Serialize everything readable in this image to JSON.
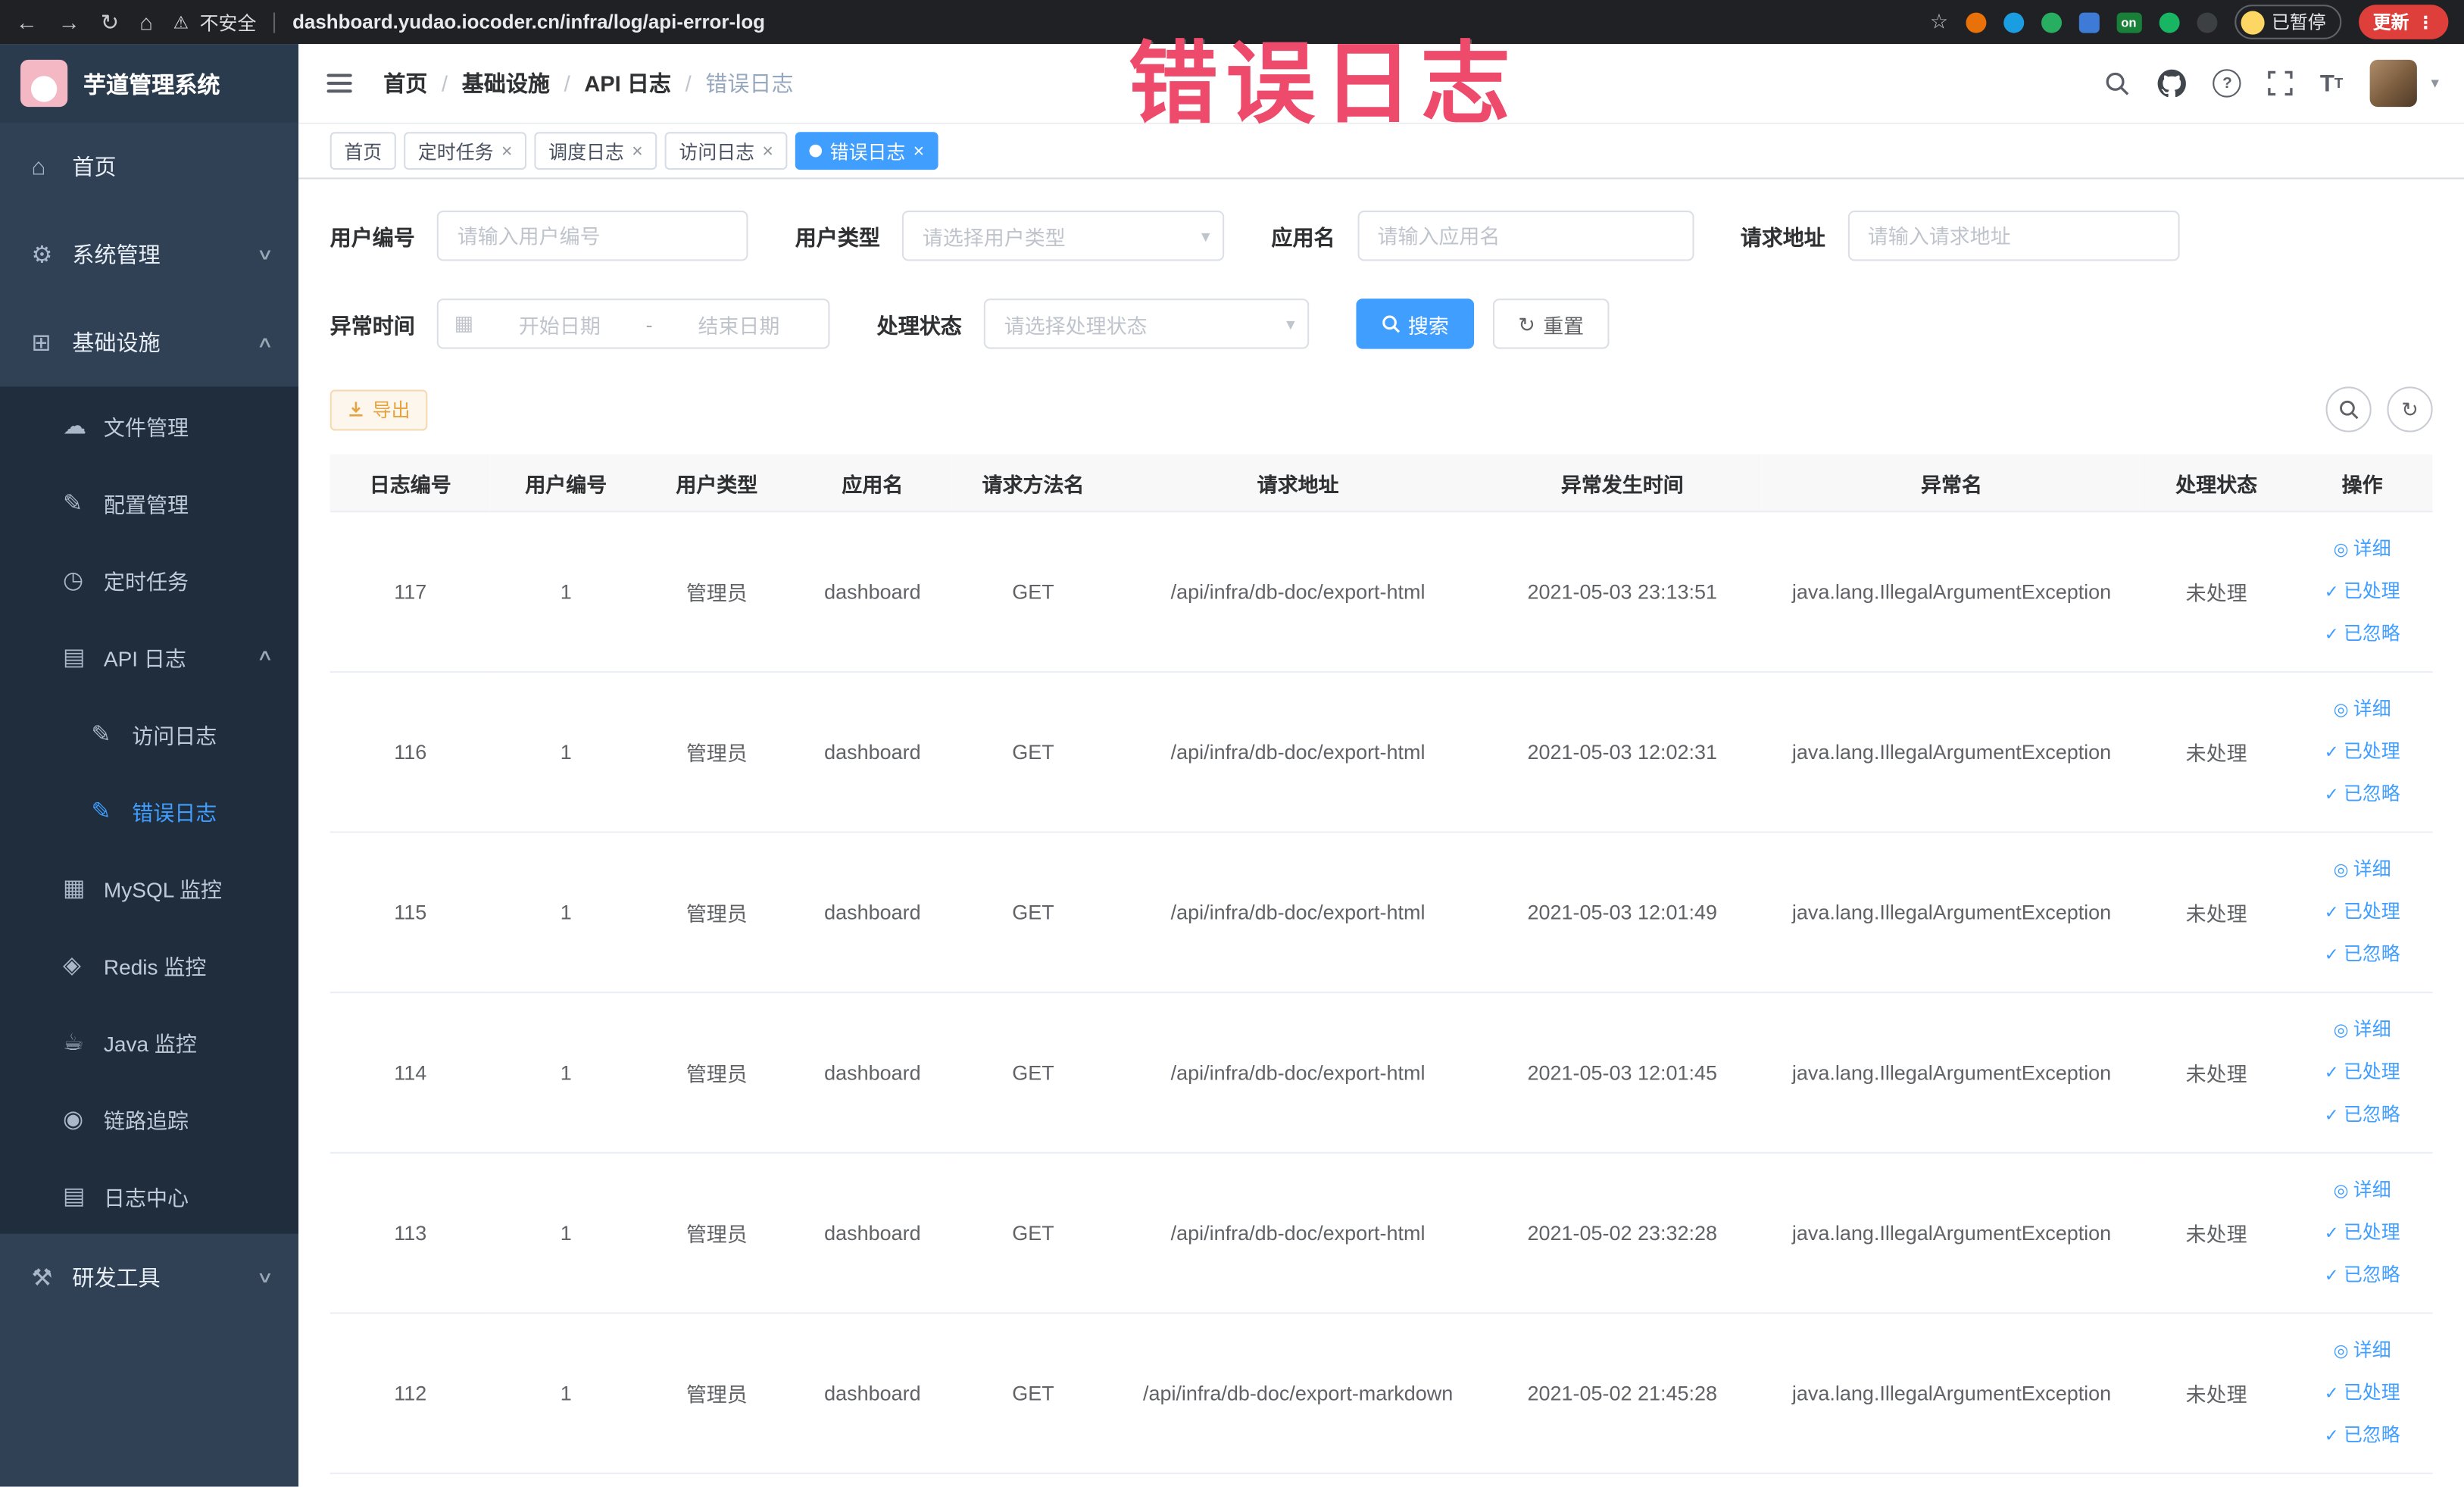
{
  "browser": {
    "security_label": "不安全",
    "url": "dashboard.yudao.iocoder.cn/infra/log/api-error-log",
    "extension_on_label": "on",
    "profile_paused_label": "已暂停",
    "update_label": "更新"
  },
  "annotation": {
    "text": "错误日志",
    "color": "#ee4a6b"
  },
  "sidebar": {
    "logo_title": "芋道管理系统",
    "items": [
      {
        "id": "home",
        "label": "首页",
        "icon": "home-icon",
        "glyph": "⌂",
        "level": 1
      },
      {
        "id": "system-management",
        "label": "系统管理",
        "icon": "gear-icon",
        "glyph": "⚙",
        "level": 1,
        "chevron": "down"
      },
      {
        "id": "infrastructure",
        "label": "基础设施",
        "icon": "infrastructure-icon",
        "glyph": "⊞",
        "level": 1,
        "chevron": "up"
      },
      {
        "id": "file-management",
        "label": "文件管理",
        "icon": "cloud-icon",
        "glyph": "☁",
        "level": 2
      },
      {
        "id": "config-management",
        "label": "配置管理",
        "icon": "edit-icon",
        "glyph": "✎",
        "level": 2
      },
      {
        "id": "scheduled-tasks",
        "label": "定时任务",
        "icon": "timer-icon",
        "glyph": "◷",
        "level": 2
      },
      {
        "id": "api-logs",
        "label": "API 日志",
        "icon": "log-icon",
        "glyph": "▤",
        "level": 2,
        "chevron": "up"
      },
      {
        "id": "access-log",
        "label": "访问日志",
        "icon": "edit-square-icon",
        "glyph": "✎",
        "level": 3
      },
      {
        "id": "error-log",
        "label": "错误日志",
        "icon": "edit-square-icon",
        "glyph": "✎",
        "level": 3,
        "active": true
      },
      {
        "id": "mysql-monitor",
        "label": "MySQL 监控",
        "icon": "monitor-icon",
        "glyph": "▦",
        "level": 2
      },
      {
        "id": "redis-monitor",
        "label": "Redis 监控",
        "icon": "database-icon",
        "glyph": "◈",
        "level": 2
      },
      {
        "id": "java-monitor",
        "label": "Java 监控",
        "icon": "coffee-icon",
        "glyph": "☕",
        "level": 2
      },
      {
        "id": "link-trace",
        "label": "链路追踪",
        "icon": "eye-icon",
        "glyph": "◉",
        "level": 2
      },
      {
        "id": "log-center",
        "label": "日志中心",
        "icon": "log-icon",
        "glyph": "▤",
        "level": 2
      },
      {
        "id": "dev-tools",
        "label": "研发工具",
        "icon": "tools-icon",
        "glyph": "⚒",
        "level": 1,
        "chevron": "down"
      }
    ]
  },
  "topbar": {
    "breadcrumb": [
      "首页",
      "基础设施",
      "API 日志",
      "错误日志"
    ],
    "breadcrumb_separator": "/"
  },
  "tags": [
    {
      "label": "首页",
      "closable": false,
      "active": false
    },
    {
      "label": "定时任务",
      "closable": true,
      "active": false
    },
    {
      "label": "调度日志",
      "closable": true,
      "active": false
    },
    {
      "label": "访问日志",
      "closable": true,
      "active": false
    },
    {
      "label": "错误日志",
      "closable": true,
      "active": true
    }
  ],
  "filters": {
    "user_id": {
      "label": "用户编号",
      "placeholder": "请输入用户编号",
      "value": ""
    },
    "user_type": {
      "label": "用户类型",
      "placeholder": "请选择用户类型"
    },
    "app_name": {
      "label": "应用名",
      "placeholder": "请输入应用名",
      "value": ""
    },
    "request_url": {
      "label": "请求地址",
      "placeholder": "请输入请求地址",
      "value": ""
    },
    "exception_time": {
      "label": "异常时间",
      "start_placeholder": "开始日期",
      "separator": "-",
      "end_placeholder": "结束日期"
    },
    "process_status": {
      "label": "处理状态",
      "placeholder": "请选择处理状态"
    },
    "search_label": "搜索",
    "reset_label": "重置"
  },
  "toolbar": {
    "export_label": "导出"
  },
  "table": {
    "columns": [
      "日志编号",
      "用户编号",
      "用户类型",
      "应用名",
      "请求方法名",
      "请求地址",
      "异常发生时间",
      "异常名",
      "处理状态",
      "操作"
    ],
    "rows": [
      [
        "117",
        "1",
        "管理员",
        "dashboard",
        "GET",
        "/api/infra/db-doc/export-html",
        "2021-05-03 23:13:51",
        "java.lang.IllegalArgumentException",
        "未处理"
      ],
      [
        "116",
        "1",
        "管理员",
        "dashboard",
        "GET",
        "/api/infra/db-doc/export-html",
        "2021-05-03 12:02:31",
        "java.lang.IllegalArgumentException",
        "未处理"
      ],
      [
        "115",
        "1",
        "管理员",
        "dashboard",
        "GET",
        "/api/infra/db-doc/export-html",
        "2021-05-03 12:01:49",
        "java.lang.IllegalArgumentException",
        "未处理"
      ],
      [
        "114",
        "1",
        "管理员",
        "dashboard",
        "GET",
        "/api/infra/db-doc/export-html",
        "2021-05-03 12:01:45",
        "java.lang.IllegalArgumentException",
        "未处理"
      ],
      [
        "113",
        "1",
        "管理员",
        "dashboard",
        "GET",
        "/api/infra/db-doc/export-html",
        "2021-05-02 23:32:28",
        "java.lang.IllegalArgumentException",
        "未处理"
      ],
      [
        "112",
        "1",
        "管理员",
        "dashboard",
        "GET",
        "/api/infra/db-doc/export-markdown",
        "2021-05-02 21:45:28",
        "java.lang.IllegalArgumentException",
        "未处理"
      ]
    ],
    "row_actions": [
      {
        "label": "详细",
        "icon": "eye-icon",
        "glyph": "◎"
      },
      {
        "label": "已处理",
        "icon": "check-icon",
        "glyph": "✓"
      },
      {
        "label": "已忽略",
        "icon": "check-icon",
        "glyph": "✓"
      }
    ]
  },
  "colors": {
    "primary": "#409eff",
    "sidebar_bg": "#304156",
    "submenu_bg": "#1f2d3d",
    "tag_active_bg": "#409eff",
    "export_text": "#e6a23c",
    "annotation": "#ee4a6b"
  }
}
